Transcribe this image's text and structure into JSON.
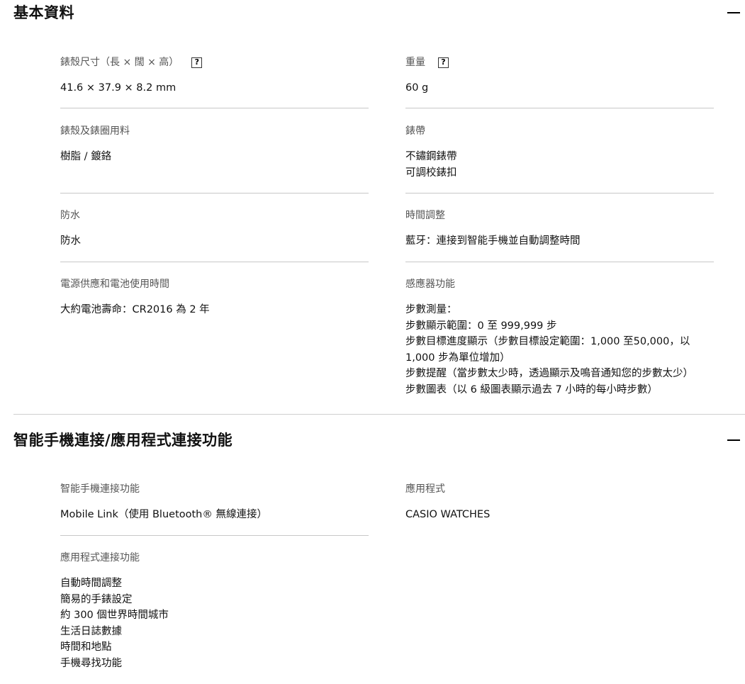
{
  "sections": [
    {
      "title": "基本資料",
      "specs": [
        {
          "label": "錶殼尺寸（長 × 闊 × 高）",
          "help": "?",
          "lines": [
            "41.6 × 37.9 × 8.2 mm"
          ]
        },
        {
          "label": "重量",
          "help": "?",
          "lines": [
            "60 g"
          ]
        },
        {
          "label": "錶殼及錶圈用料",
          "lines": [
            "樹脂 / 鍍鉻"
          ]
        },
        {
          "label": "錶帶",
          "lines": [
            "不鏽鋼錶帶",
            "可調校錶扣"
          ]
        },
        {
          "label": "防水",
          "lines": [
            "防水"
          ]
        },
        {
          "label": "時間調整",
          "lines": [
            "藍牙：連接到智能手機並自動調整時間"
          ]
        },
        {
          "label": "電源供應和電池使用時間",
          "lines": [
            "大約電池壽命：CR2016 為 2 年"
          ]
        },
        {
          "label": "感應器功能",
          "lines": [
            "步數測量：",
            "步數顯示範圍：0 至 999,999 步",
            "步數目標進度顯示（步數目標設定範圍：1,000 至50,000，以",
            "1,000 步為單位增加）",
            "步數提醒（當步數太少時，透過顯示及鳴音通知您的步數太少）",
            "步數圖表（以 6 級圖表顯示過去 7 小時的每小時步數）"
          ]
        }
      ]
    },
    {
      "title": "智能手機連接/應用程式連接功能",
      "specs": [
        {
          "label": "智能手機連接功能",
          "lines": [
            "Mobile Link（使用 Bluetooth® 無線連接）"
          ]
        },
        {
          "label": "應用程式",
          "lines": [
            "CASIO WATCHES"
          ]
        },
        {
          "label": "應用程式連接功能",
          "lines": [
            "自動時間調整",
            "簡易的手錶設定",
            "約 300 個世界時間城市",
            "生活日誌數據",
            "時間和地點",
            "手機尋找功能"
          ]
        }
      ]
    }
  ]
}
